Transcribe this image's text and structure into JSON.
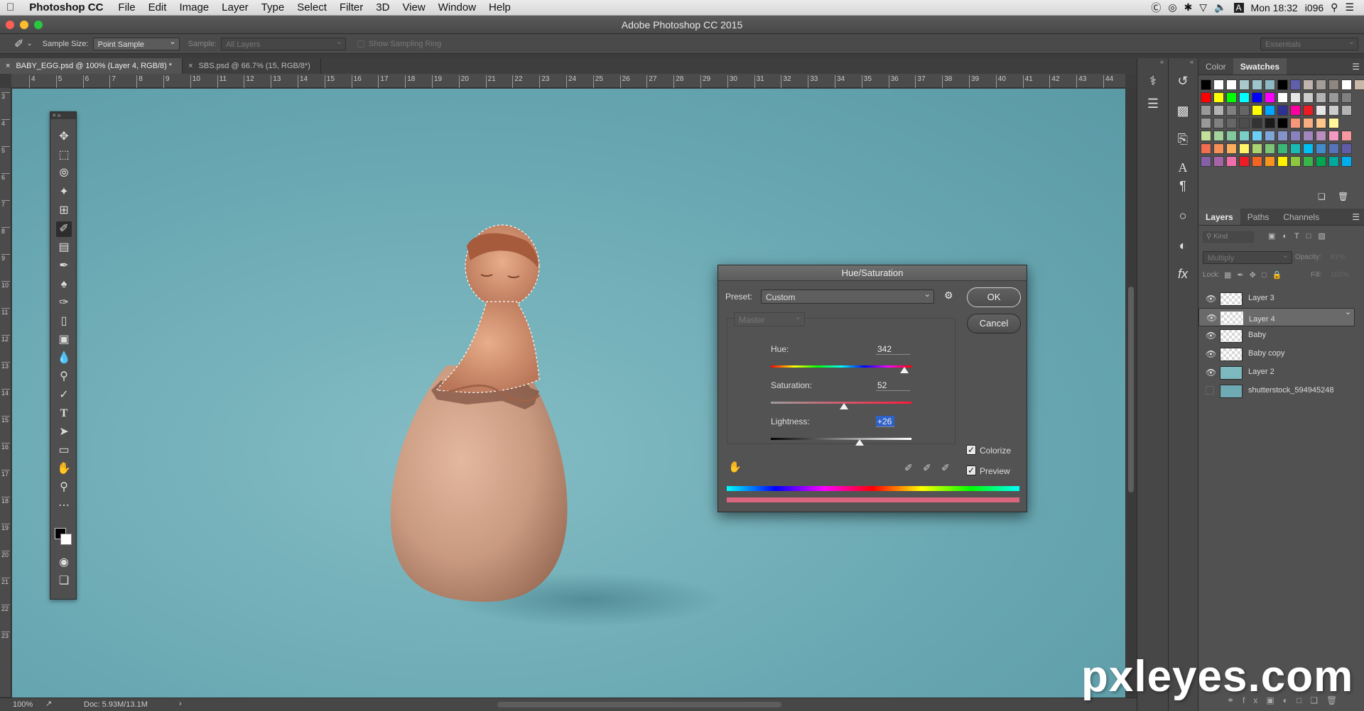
{
  "menubar": {
    "apple": "",
    "app_name": "Photoshop CC",
    "items": [
      "File",
      "Edit",
      "Image",
      "Layer",
      "Type",
      "Select",
      "Filter",
      "3D",
      "View",
      "Window",
      "Help"
    ],
    "clock": "Mon 18:32",
    "user": "i096"
  },
  "window": {
    "title": "Adobe Photoshop CC 2015"
  },
  "options_bar": {
    "sample_size_label": "Sample Size:",
    "sample_size_value": "Point Sample",
    "sample_label": "Sample:",
    "sample_value": "All Layers",
    "show_ring_label": "Show Sampling Ring",
    "workspace": "Essentials"
  },
  "tabs": [
    {
      "label": "BABY_EGG.psd @ 100% (Layer 4, RGB/8) *",
      "active": true
    },
    {
      "label": "SBS.psd @ 66.7% (15, RGB/8*)",
      "active": false
    }
  ],
  "ruler": {
    "h_ticks": [
      "4",
      "5",
      "6",
      "7",
      "8",
      "9",
      "10",
      "11",
      "12",
      "13",
      "14",
      "15",
      "16",
      "17",
      "18",
      "19",
      "20",
      "21",
      "22",
      "23",
      "24",
      "25",
      "26",
      "27",
      "28",
      "29",
      "30",
      "31",
      "32",
      "33",
      "34",
      "35",
      "36",
      "37",
      "38",
      "39",
      "40",
      "41",
      "42",
      "43",
      "44"
    ],
    "v_ticks": [
      "3",
      "4",
      "5",
      "6",
      "7",
      "8",
      "9",
      "10",
      "11",
      "12",
      "13",
      "14",
      "15",
      "16",
      "17",
      "18",
      "19",
      "20",
      "21",
      "22",
      "23"
    ]
  },
  "status": {
    "zoom": "100%",
    "doc": "Doc: 5.93M/13.1M"
  },
  "swatches_panel": {
    "tabs": [
      "Color",
      "Swatches"
    ],
    "rows": [
      [
        "#000000",
        "#ffffff",
        "#ffffff",
        "#a8c8cc",
        "#9ec4cc",
        "#8fb8c2",
        "#000000",
        "#5f5fae",
        "#bfb4ae",
        "#a59c96",
        "#8f8680",
        "#ffffff",
        "#c9b8a8",
        "#000000"
      ],
      [
        "#ff0000",
        "#ffff00",
        "#00ff00",
        "#00ffff",
        "#0000ff",
        "#ff00ff",
        "#ffffff",
        "#e6e6e6",
        "#cccccc",
        "#b3b3b3",
        "#999999",
        "#808080"
      ],
      [
        "#999999",
        "#b3b3b3",
        "#808080",
        "#666666",
        "#ffff00",
        "#00a6ff",
        "#2e3192",
        "#ff00a0",
        "#ed1c24",
        "#e6e6e6",
        "#cccccc",
        "#b3b3b3"
      ],
      [
        "#999999",
        "#808080",
        "#666666",
        "#4d4d4d",
        "#333333",
        "#1a1a1a",
        "#000000",
        "#f7977a",
        "#f9ad81",
        "#fdc68a",
        "#fff79a"
      ],
      [
        "#c4df9b",
        "#a3d39c",
        "#82ca9d",
        "#7bcdc8",
        "#6ecff6",
        "#7ea7d8",
        "#8493ca",
        "#8882be",
        "#a187be",
        "#bc8dbf",
        "#f49ac2",
        "#f6989d"
      ],
      [
        "#f26c4f",
        "#f68e55",
        "#fbaf5c",
        "#fff467",
        "#acd372",
        "#7cc576",
        "#3bb878",
        "#1abbb4",
        "#00bff3",
        "#438ccb",
        "#5574b9",
        "#605ca8"
      ],
      [
        "#855fa8",
        "#a763a8",
        "#f06ea9",
        "#ed1c24",
        "#f26522",
        "#f7941d",
        "#fff200",
        "#8dc73f",
        "#39b54a",
        "#00a651",
        "#00a99d",
        "#00aeef"
      ]
    ]
  },
  "layers_panel": {
    "tabs": [
      "Layers",
      "Paths",
      "Channels"
    ],
    "kind_placeholder": "Kind",
    "blend_mode": "Multiply",
    "opacity_label": "Opacity:",
    "opacity_value": "81%",
    "lock_label": "Lock:",
    "fill_label": "Fill:",
    "fill_value": "100%",
    "layers": [
      {
        "name": "Layer 3",
        "visible": true,
        "selected": false
      },
      {
        "name": "Layer 4",
        "visible": true,
        "selected": true
      },
      {
        "name": "Baby",
        "visible": true,
        "selected": false
      },
      {
        "name": "Baby copy",
        "visible": true,
        "selected": false
      },
      {
        "name": "Layer 2",
        "visible": true,
        "selected": false
      },
      {
        "name": "shutterstock_594945248",
        "visible": false,
        "selected": false
      }
    ]
  },
  "dialog": {
    "title": "Hue/Saturation",
    "preset_label": "Preset:",
    "preset_value": "Custom",
    "channel": "Master",
    "hue_label": "Hue:",
    "hue_value": "342",
    "hue_fraction": 0.95,
    "saturation_label": "Saturation:",
    "saturation_value": "52",
    "saturation_fraction": 0.52,
    "lightness_label": "Lightness:",
    "lightness_value": "+26",
    "lightness_fraction": 0.63,
    "ok": "OK",
    "cancel": "Cancel",
    "colorize_label": "Colorize",
    "colorize_checked": true,
    "preview_label": "Preview",
    "preview_checked": true
  },
  "watermark": "pxleyes.com"
}
